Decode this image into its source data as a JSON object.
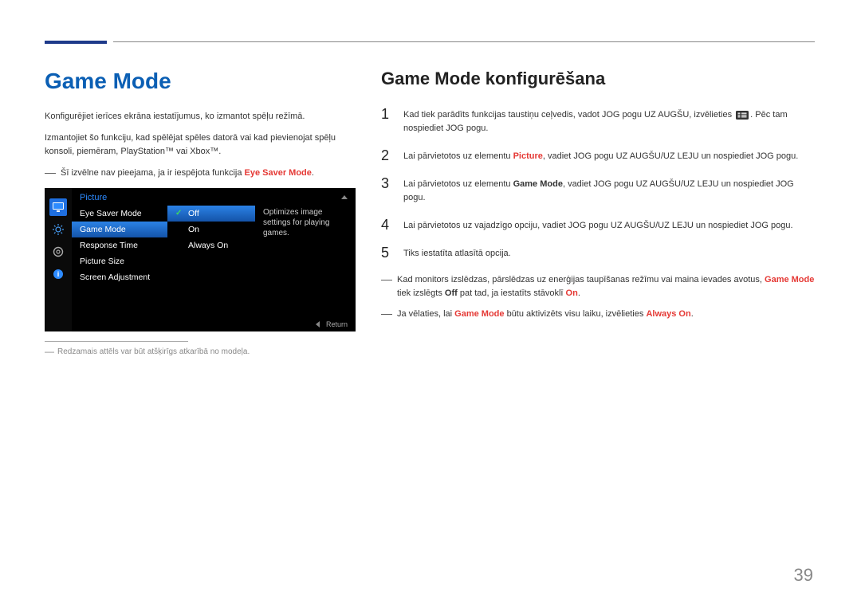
{
  "page_number": "39",
  "header_accent_color": "#1e3a8a",
  "left": {
    "title": "Game Mode",
    "desc1": "Konfigurējiet ierīces ekrāna iestatījumus, ko izmantot spēļu režīmā.",
    "desc2": "Izmantojiet šo funkciju, kad spēlējat spēles datorā vai kad pievienojat spēļu konsoli, piemēram, PlayStation™ vai Xbox™.",
    "note_text": "Šī izvēlne nav pieejama, ja ir iespējota funkcija ",
    "note_hl": "Eye Saver Mode",
    "note_tail": ".",
    "footnote": "Redzamais attēls var būt atšķirīgs atkarībā no modeļa."
  },
  "osd": {
    "header": "Picture",
    "items": [
      "Eye Saver Mode",
      "Game Mode",
      "Response Time",
      "Picture Size",
      "Screen Adjustment"
    ],
    "selected_item_index": 1,
    "options": [
      "Off",
      "On",
      "Always On"
    ],
    "selected_option_index": 0,
    "help_text": "Optimizes image settings for playing games.",
    "return_label": "Return",
    "icons": [
      "monitor-icon",
      "brightness-icon",
      "gear-icon",
      "info-icon"
    ]
  },
  "right": {
    "title": "Game Mode konfigurēšana",
    "steps": [
      {
        "num": "1",
        "pre": "Kad tiek parādīts funkcijas taustiņu ceļvedis, vadot JOG pogu UZ AUGŠU, izvēlieties ",
        "icon": "menu-icon",
        "post": ". Pēc tam nospiediet JOG pogu."
      },
      {
        "num": "2",
        "pre": "Lai pārvietotos uz elementu ",
        "bold": "Picture",
        "bold_red": true,
        "post": ", vadiet JOG pogu UZ AUGŠU/UZ LEJU un nospiediet JOG pogu."
      },
      {
        "num": "3",
        "pre": "Lai pārvietotos uz elementu ",
        "bold": "Game Mode",
        "bold_red": false,
        "post": ", vadiet JOG pogu UZ AUGŠU/UZ LEJU un nospiediet JOG pogu."
      },
      {
        "num": "4",
        "pre": "Lai pārvietotos uz vajadzīgo opciju, vadiet JOG pogu UZ AUGŠU/UZ LEJU un nospiediet JOG pogu."
      },
      {
        "num": "5",
        "pre": "Tiks iestatīta atlasītā opcija."
      }
    ],
    "notes": [
      {
        "parts": [
          {
            "t": "Kad monitors izslēdzas, pārslēdzas uz enerģijas taupīšanas režīmu vai maina ievades avotus, "
          },
          {
            "t": "Game Mode",
            "bold_red": true
          },
          {
            "t": " tiek izslēgts "
          },
          {
            "t": "Off",
            "bold": true
          },
          {
            "t": " pat tad, ja iestatīts stāvoklī "
          },
          {
            "t": "On",
            "bold_red": true
          },
          {
            "t": "."
          }
        ]
      },
      {
        "parts": [
          {
            "t": "Ja vēlaties, lai "
          },
          {
            "t": "Game Mode",
            "bold_red": true
          },
          {
            "t": " būtu aktivizēts visu laiku, izvēlieties "
          },
          {
            "t": "Always On",
            "bold_red": true
          },
          {
            "t": "."
          }
        ]
      }
    ]
  }
}
